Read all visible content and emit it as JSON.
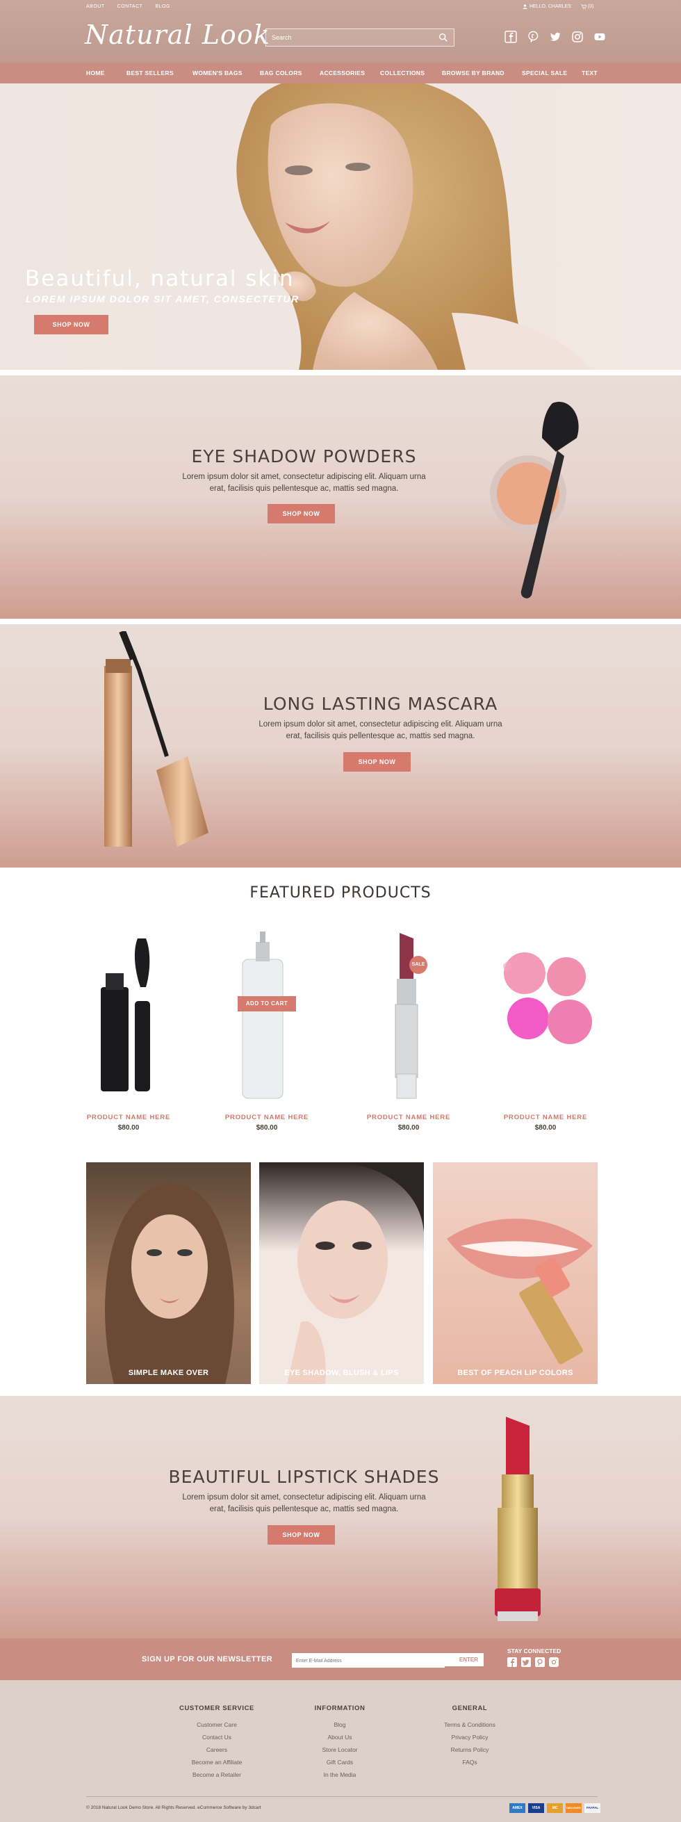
{
  "header": {
    "top_links": [
      "ABOUT",
      "CONTACT",
      "BLOG"
    ],
    "greeting": "HELLO, CHARLES",
    "cart_count": "(0)",
    "logo": "Natural Look",
    "search_placeholder": "Search"
  },
  "nav": [
    "HOME",
    "BEST SELLERS",
    "WOMEN'S BAGS",
    "BAG COLORS",
    "ACCESSORIES",
    "COLLECTIONS",
    "BROWSE BY BRAND",
    "SPECIAL SALE",
    "TEXT"
  ],
  "hero": {
    "title": "Beautiful, natural skin",
    "subtitle": "LOREM IPSUM DOLOR SIT AMET, CONSECTETUR",
    "button": "SHOP NOW"
  },
  "promo1": {
    "title": "EYE SHADOW POWDERS",
    "text_line1": "Lorem ipsum dolor sit amet, consectetur adipiscing elit. Aliquam urna",
    "text_line2": "erat, facilisis quis pellentesque ac, mattis sed magna.",
    "button": "SHOP NOW"
  },
  "promo2": {
    "title": "LONG LASTING MASCARA",
    "text_line1": "Lorem ipsum dolor sit amet, consectetur adipiscing elit. Aliquam urna",
    "text_line2": "erat, facilisis quis pellentesque ac, mattis sed magna.",
    "button": "SHOP NOW"
  },
  "featured": {
    "title": "FEATURED PRODUCTS",
    "add_to_cart": "ADD TO CART",
    "sale_badge": "SALE",
    "products": [
      {
        "name": "PRODUCT NAME HERE",
        "price": "$80.00"
      },
      {
        "name": "PRODUCT NAME HERE",
        "price": "$80.00"
      },
      {
        "name": "PRODUCT NAME HERE",
        "price": "$80.00"
      },
      {
        "name": "PRODUCT NAME HERE",
        "price": "$80.00"
      }
    ]
  },
  "tiles": [
    "SIMPLE MAKE OVER",
    "EYE SHADOW, BLUSH & LIPS",
    "BEST OF PEACH LIP COLORS"
  ],
  "promo3": {
    "title": "BEAUTIFUL LIPSTICK SHADES",
    "text_line1": "Lorem ipsum dolor sit amet, consectetur adipiscing elit. Aliquam urna",
    "text_line2": "erat, facilisis quis pellentesque ac, mattis sed magna.",
    "button": "SHOP NOW"
  },
  "newsletter": {
    "label": "SIGN UP FOR OUR NEWSLETTER",
    "placeholder": "Enter E-Mail Address",
    "button": "ENTER",
    "stay_connected": "STAY CONNECTED"
  },
  "footer": {
    "columns": [
      {
        "title": "CUSTOMER SERVICE",
        "items": [
          "Customer Care",
          "Contact Us",
          "Careers",
          "Become an Affiliate",
          "Become a Retailer"
        ]
      },
      {
        "title": "INFORMATION",
        "items": [
          "Blog",
          "About Us",
          "Store Locator",
          "Gift Cards",
          "In the Media"
        ]
      },
      {
        "title": "GENERAL",
        "items": [
          "Terms & Conditions",
          "Privacy Policy",
          "Returns Policy",
          "FAQs"
        ]
      }
    ],
    "copyright": "© 2018 Natural Look Demo Store. All Rights Reserved. eCommerce Software by 3dcart",
    "payments": [
      "AMEX",
      "VISA",
      "MC",
      "DISCOVER",
      "PAYPAL"
    ]
  },
  "colors": {
    "accent": "#c98d82",
    "button": "#d57a6c",
    "product_name": "#d0786a"
  },
  "icons": [
    "search-icon",
    "user-icon",
    "cart-icon",
    "facebook-icon",
    "pinterest-icon",
    "twitter-icon",
    "instagram-icon",
    "youtube-icon"
  ]
}
